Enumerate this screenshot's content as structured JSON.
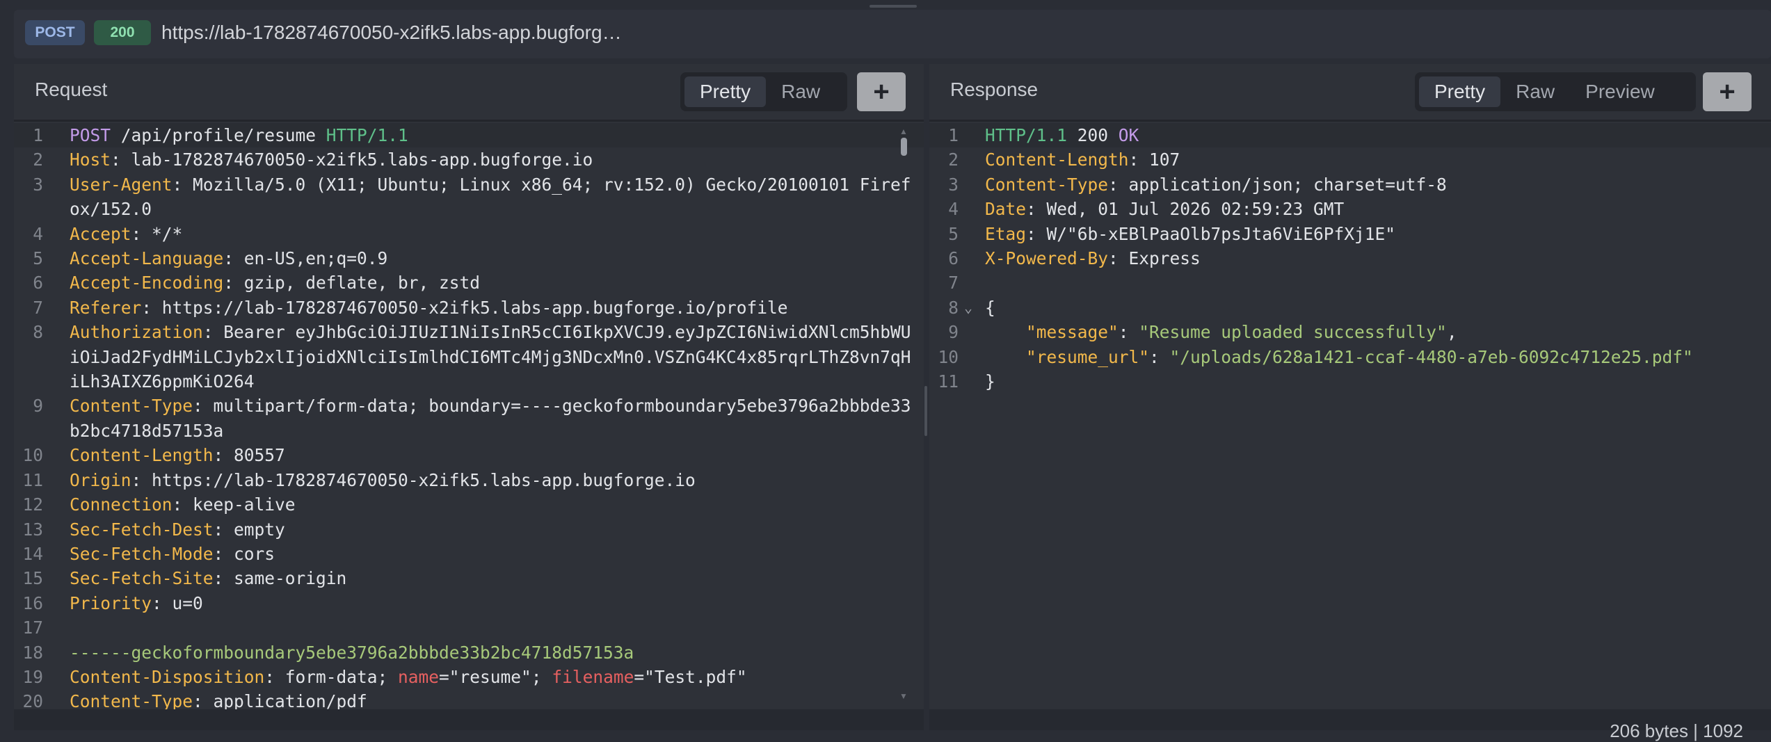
{
  "request_bar": {
    "method": "POST",
    "status": "200",
    "url": "https://lab-1782874670050-x2ifk5.labs-app.bugforg…"
  },
  "request_pane": {
    "title": "Request",
    "tabs": [
      "Pretty",
      "Raw"
    ],
    "add_label": "+"
  },
  "response_pane": {
    "title": "Response",
    "tabs": [
      "Pretty",
      "Raw",
      "Preview"
    ],
    "add_label": "+",
    "footer_info": "206 bytes | 1092"
  },
  "request_lines": [
    {
      "n": "1",
      "segs": [
        [
          "POST",
          "meth"
        ],
        [
          " /api/profile/resume ",
          ""
        ],
        [
          "HTTP/1.1",
          "ver"
        ]
      ]
    },
    {
      "n": "2",
      "segs": [
        [
          "Host",
          "hdr"
        ],
        [
          ": lab-1782874670050-x2ifk5.labs-app.bugforge.io",
          ""
        ]
      ]
    },
    {
      "n": "3",
      "segs": [
        [
          "User-Agent",
          "hdr"
        ],
        [
          ": Mozilla/5.0 (X11; Ubuntu; Linux x86_64; rv:152.0) Gecko/20100101 Firefox/152.0",
          ""
        ]
      ]
    },
    {
      "n": "4",
      "segs": [
        [
          "Accept",
          "hdr"
        ],
        [
          ": */*",
          ""
        ]
      ]
    },
    {
      "n": "5",
      "segs": [
        [
          "Accept-Language",
          "hdr"
        ],
        [
          ": en-US,en;q=0.9",
          ""
        ]
      ]
    },
    {
      "n": "6",
      "segs": [
        [
          "Accept-Encoding",
          "hdr"
        ],
        [
          ": gzip, deflate, br, zstd",
          ""
        ]
      ]
    },
    {
      "n": "7",
      "segs": [
        [
          "Referer",
          "hdr"
        ],
        [
          ": https://lab-1782874670050-x2ifk5.labs-app.bugforge.io/profile",
          ""
        ]
      ]
    },
    {
      "n": "8",
      "segs": [
        [
          "Authorization",
          "hdr"
        ],
        [
          ": Bearer eyJhbGciOiJIUzI1NiIsInR5cCI6IkpXVCJ9.eyJpZCI6NiwidXNlcm5hbWUiOiJad2FydHMiLCJyb2xlIjoidXNlciIsImlhdCI6MTc4Mjg3NDcxMn0.VSZnG4KC4x85rqrLThZ8vn7qHiLh3AIXZ6ppmKiO264",
          ""
        ]
      ]
    },
    {
      "n": "9",
      "segs": [
        [
          "Content-Type",
          "hdr"
        ],
        [
          ": multipart/form-data; boundary=----geckoformboundary5ebe3796a2bbbde33b2bc4718d57153a",
          ""
        ]
      ]
    },
    {
      "n": "10",
      "segs": [
        [
          "Content-Length",
          "hdr"
        ],
        [
          ": 80557",
          ""
        ]
      ]
    },
    {
      "n": "11",
      "segs": [
        [
          "Origin",
          "hdr"
        ],
        [
          ": https://lab-1782874670050-x2ifk5.labs-app.bugforge.io",
          ""
        ]
      ]
    },
    {
      "n": "12",
      "segs": [
        [
          "Connection",
          "hdr"
        ],
        [
          ": keep-alive",
          ""
        ]
      ]
    },
    {
      "n": "13",
      "segs": [
        [
          "Sec-Fetch-Dest",
          "hdr"
        ],
        [
          ": empty",
          ""
        ]
      ]
    },
    {
      "n": "14",
      "segs": [
        [
          "Sec-Fetch-Mode",
          "hdr"
        ],
        [
          ": cors",
          ""
        ]
      ]
    },
    {
      "n": "15",
      "segs": [
        [
          "Sec-Fetch-Site",
          "hdr"
        ],
        [
          ": same-origin",
          ""
        ]
      ]
    },
    {
      "n": "16",
      "segs": [
        [
          "Priority",
          "hdr"
        ],
        [
          ": u=0",
          ""
        ]
      ]
    },
    {
      "n": "17",
      "segs": []
    },
    {
      "n": "18",
      "segs": [
        [
          "------geckoformboundary5ebe3796a2bbbde33b2bc4718d57153a",
          "bnd"
        ]
      ]
    },
    {
      "n": "19",
      "segs": [
        [
          "Content-Disposition",
          "hdr"
        ],
        [
          ": form-data; ",
          ""
        ],
        [
          "name",
          "attr"
        ],
        [
          "=\"resume\"; ",
          ""
        ],
        [
          "filename",
          "attr"
        ],
        [
          "=\"Test.pdf\"",
          ""
        ]
      ]
    },
    {
      "n": "20",
      "segs": [
        [
          "Content-Type",
          "hdr"
        ],
        [
          ": application/pdf",
          ""
        ]
      ]
    }
  ],
  "response_lines": [
    {
      "n": "1",
      "segs": [
        [
          "HTTP/1.1",
          "ver"
        ],
        [
          " 200 ",
          ""
        ],
        [
          "OK",
          "ok"
        ]
      ]
    },
    {
      "n": "2",
      "segs": [
        [
          "Content-Length",
          "hdr"
        ],
        [
          ": 107",
          ""
        ]
      ]
    },
    {
      "n": "3",
      "segs": [
        [
          "Content-Type",
          "hdr"
        ],
        [
          ": application/json; charset=utf-8",
          ""
        ]
      ]
    },
    {
      "n": "4",
      "segs": [
        [
          "Date",
          "hdr"
        ],
        [
          ": Wed, 01 Jul 2026 02:59:23 GMT",
          ""
        ]
      ]
    },
    {
      "n": "5",
      "segs": [
        [
          "Etag",
          "hdr"
        ],
        [
          ": W/\"6b-xEBlPaaOlb7psJta6ViE6PfXj1E\"",
          ""
        ]
      ]
    },
    {
      "n": "6",
      "segs": [
        [
          "X-Powered-By",
          "hdr"
        ],
        [
          ": Express",
          ""
        ]
      ]
    },
    {
      "n": "7",
      "segs": []
    },
    {
      "n": "8",
      "fold": "⌄",
      "segs": [
        [
          "{",
          ""
        ]
      ]
    },
    {
      "n": "9",
      "segs": [
        [
          "    ",
          ""
        ],
        [
          "\"message\"",
          "json-key"
        ],
        [
          ": ",
          ""
        ],
        [
          "\"Resume uploaded successfully\"",
          "json-str"
        ],
        [
          ",",
          ""
        ]
      ]
    },
    {
      "n": "10",
      "segs": [
        [
          "    ",
          ""
        ],
        [
          "\"resume_url\"",
          "json-key"
        ],
        [
          ": ",
          ""
        ],
        [
          "\"/uploads/628a1421-ccaf-4480-a7eb-6092c4712e25.pdf\"",
          "json-str"
        ]
      ]
    },
    {
      "n": "11",
      "segs": [
        [
          "}",
          ""
        ]
      ]
    }
  ],
  "colors": {
    "header_name": "#f2b84b",
    "method": "#c39be8",
    "http_version": "#5fc08a",
    "attr": "#e66060",
    "boundary": "#a7c97a"
  }
}
